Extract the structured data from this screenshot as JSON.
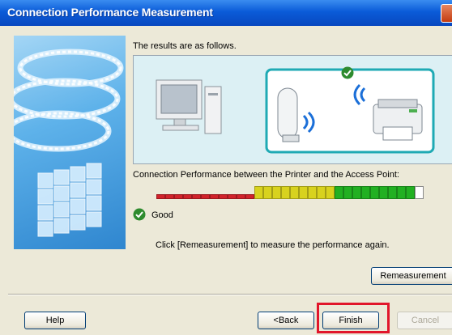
{
  "window": {
    "title": "Connection Performance Measurement"
  },
  "instruction": "The results are as follows.",
  "illustration": {
    "left_device": "computer-icon",
    "right_devices": [
      "access-point-icon",
      "printer-icon"
    ],
    "connection_status_icon": "check-icon"
  },
  "performance": {
    "label": "Connection Performance between the Printer and the Access Point:",
    "segments_total": 30,
    "segments_lit": 29,
    "level_fraction": 0.97,
    "colors": {
      "red": "#d0222a",
      "yellow": "#d8d21e",
      "green": "#22b022",
      "empty": "#ffffff"
    }
  },
  "result": {
    "icon": "check-icon",
    "text": "Good"
  },
  "hint": "Click [Remeasurement] to measure the performance again.",
  "buttons": {
    "remeasurement": "Remeasurement",
    "help": "Help",
    "back": "<Back",
    "finish": "Finish",
    "cancel": "Cancel"
  },
  "colors": {
    "highlight": "#e1162b",
    "title_bar": "#0a5bd8",
    "accent_teal": "#1faab4"
  }
}
